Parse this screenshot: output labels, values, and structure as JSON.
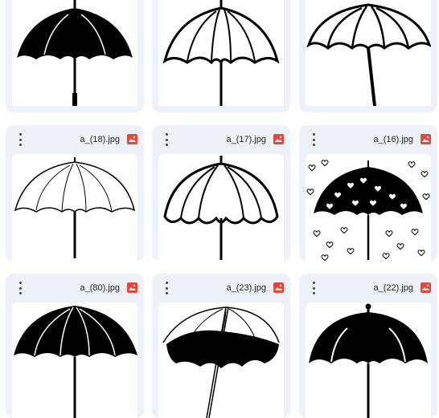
{
  "files": [
    {
      "name": "",
      "icon": "image-file-icon",
      "thumb": "umbrella-solid-black-icon"
    },
    {
      "name": "",
      "icon": "image-file-icon",
      "thumb": "umbrella-outline-icon"
    },
    {
      "name": "",
      "icon": "image-file-icon",
      "thumb": "umbrella-outline-ribbed-icon"
    },
    {
      "name": "a_(18).jpg",
      "icon": "image-file-icon",
      "thumb": "umbrella-sketch-icon"
    },
    {
      "name": "a_(17).jpg",
      "icon": "image-file-icon",
      "thumb": "umbrella-outline-scalloped-icon"
    },
    {
      "name": "a_(16).jpg",
      "icon": "image-file-icon",
      "thumb": "umbrella-hearts-icon"
    },
    {
      "name": "a_(80).jpg",
      "icon": "image-file-icon",
      "thumb": "umbrella-black-white-ribs-icon"
    },
    {
      "name": "a_(23).jpg",
      "icon": "image-file-icon",
      "thumb": "umbrella-tilted-icon"
    },
    {
      "name": "a_(22).jpg",
      "icon": "image-file-icon",
      "thumb": "umbrella-black-finial-icon"
    }
  ],
  "colors": {
    "card_bg": "#eef2f8",
    "image_icon": "#e5483b",
    "thumb_bg": "#ffffff"
  }
}
